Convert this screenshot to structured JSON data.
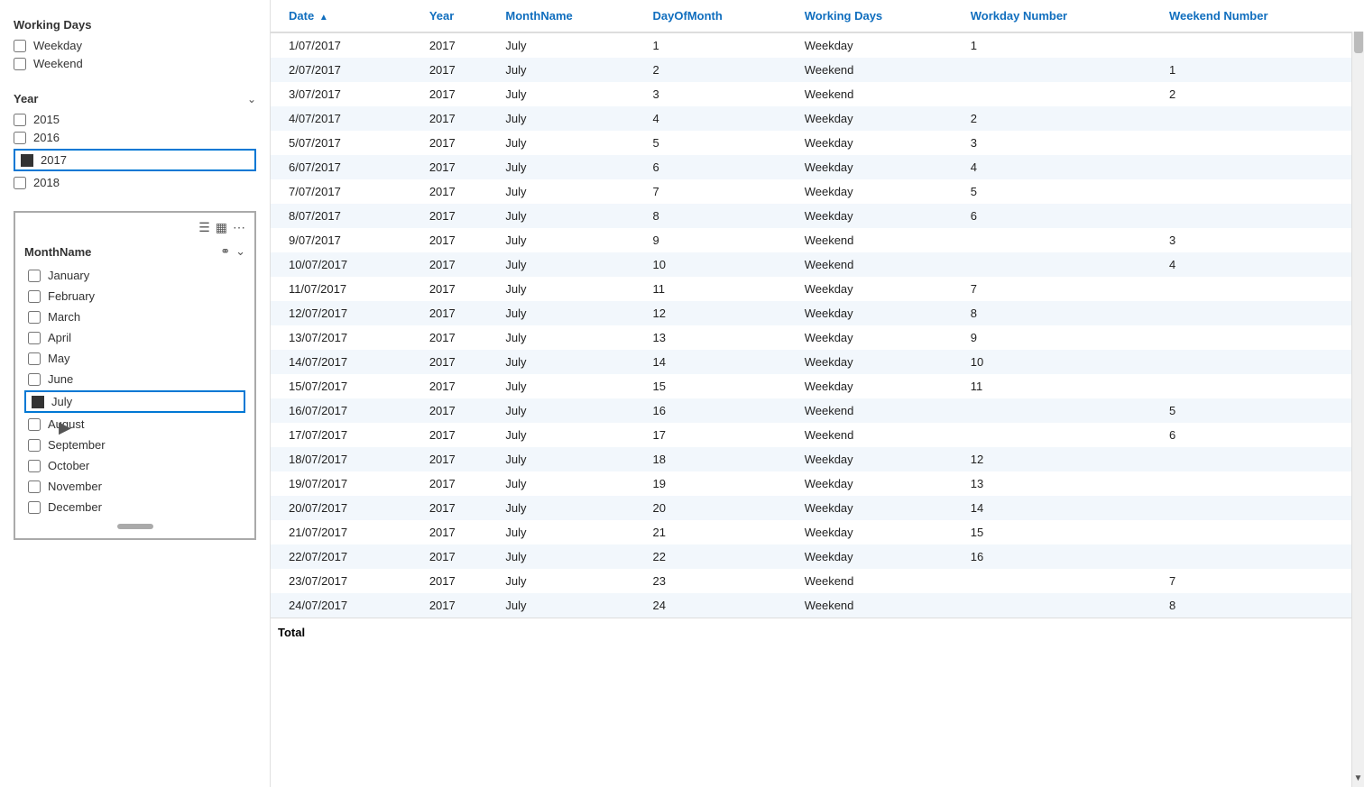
{
  "leftPanel": {
    "workingDays": {
      "title": "Working Days",
      "options": [
        {
          "label": "Weekday",
          "checked": false
        },
        {
          "label": "Weekend",
          "checked": false
        }
      ]
    },
    "year": {
      "title": "Year",
      "options": [
        {
          "label": "2015",
          "checked": false,
          "selected": false
        },
        {
          "label": "2016",
          "checked": false,
          "selected": false
        },
        {
          "label": "2017",
          "checked": true,
          "selected": true
        },
        {
          "label": "2018",
          "checked": false,
          "selected": false
        }
      ]
    },
    "monthName": {
      "title": "MonthName",
      "months": [
        {
          "label": "January",
          "checked": false,
          "selected": false
        },
        {
          "label": "February",
          "checked": false,
          "selected": false
        },
        {
          "label": "March",
          "checked": false,
          "selected": false
        },
        {
          "label": "April",
          "checked": false,
          "selected": false
        },
        {
          "label": "May",
          "checked": false,
          "selected": false
        },
        {
          "label": "June",
          "checked": false,
          "selected": false
        },
        {
          "label": "July",
          "checked": true,
          "selected": true
        },
        {
          "label": "August",
          "checked": false,
          "selected": false
        },
        {
          "label": "September",
          "checked": false,
          "selected": false
        },
        {
          "label": "October",
          "checked": false,
          "selected": false
        },
        {
          "label": "November",
          "checked": false,
          "selected": false
        },
        {
          "label": "December",
          "checked": false,
          "selected": false
        }
      ]
    }
  },
  "table": {
    "columns": [
      {
        "id": "date",
        "label": "Date",
        "sortable": true,
        "sortDir": "asc"
      },
      {
        "id": "year",
        "label": "Year"
      },
      {
        "id": "monthName",
        "label": "MonthName"
      },
      {
        "id": "dayOfMonth",
        "label": "DayOfMonth"
      },
      {
        "id": "workingDays",
        "label": "Working Days"
      },
      {
        "id": "workdayNumber",
        "label": "Workday Number"
      },
      {
        "id": "weekendNumber",
        "label": "Weekend Number"
      }
    ],
    "rows": [
      {
        "date": "1/07/2017",
        "year": "2017",
        "monthName": "July",
        "dayOfMonth": "1",
        "workingDays": "Weekday",
        "workdayNumber": "1",
        "weekendNumber": ""
      },
      {
        "date": "2/07/2017",
        "year": "2017",
        "monthName": "July",
        "dayOfMonth": "2",
        "workingDays": "Weekend",
        "workdayNumber": "",
        "weekendNumber": "1"
      },
      {
        "date": "3/07/2017",
        "year": "2017",
        "monthName": "July",
        "dayOfMonth": "3",
        "workingDays": "Weekend",
        "workdayNumber": "",
        "weekendNumber": "2"
      },
      {
        "date": "4/07/2017",
        "year": "2017",
        "monthName": "July",
        "dayOfMonth": "4",
        "workingDays": "Weekday",
        "workdayNumber": "2",
        "weekendNumber": ""
      },
      {
        "date": "5/07/2017",
        "year": "2017",
        "monthName": "July",
        "dayOfMonth": "5",
        "workingDays": "Weekday",
        "workdayNumber": "3",
        "weekendNumber": ""
      },
      {
        "date": "6/07/2017",
        "year": "2017",
        "monthName": "July",
        "dayOfMonth": "6",
        "workingDays": "Weekday",
        "workdayNumber": "4",
        "weekendNumber": ""
      },
      {
        "date": "7/07/2017",
        "year": "2017",
        "monthName": "July",
        "dayOfMonth": "7",
        "workingDays": "Weekday",
        "workdayNumber": "5",
        "weekendNumber": ""
      },
      {
        "date": "8/07/2017",
        "year": "2017",
        "monthName": "July",
        "dayOfMonth": "8",
        "workingDays": "Weekday",
        "workdayNumber": "6",
        "weekendNumber": ""
      },
      {
        "date": "9/07/2017",
        "year": "2017",
        "monthName": "July",
        "dayOfMonth": "9",
        "workingDays": "Weekend",
        "workdayNumber": "",
        "weekendNumber": "3"
      },
      {
        "date": "10/07/2017",
        "year": "2017",
        "monthName": "July",
        "dayOfMonth": "10",
        "workingDays": "Weekend",
        "workdayNumber": "",
        "weekendNumber": "4"
      },
      {
        "date": "11/07/2017",
        "year": "2017",
        "monthName": "July",
        "dayOfMonth": "11",
        "workingDays": "Weekday",
        "workdayNumber": "7",
        "weekendNumber": ""
      },
      {
        "date": "12/07/2017",
        "year": "2017",
        "monthName": "July",
        "dayOfMonth": "12",
        "workingDays": "Weekday",
        "workdayNumber": "8",
        "weekendNumber": ""
      },
      {
        "date": "13/07/2017",
        "year": "2017",
        "monthName": "July",
        "dayOfMonth": "13",
        "workingDays": "Weekday",
        "workdayNumber": "9",
        "weekendNumber": ""
      },
      {
        "date": "14/07/2017",
        "year": "2017",
        "monthName": "July",
        "dayOfMonth": "14",
        "workingDays": "Weekday",
        "workdayNumber": "10",
        "weekendNumber": ""
      },
      {
        "date": "15/07/2017",
        "year": "2017",
        "monthName": "July",
        "dayOfMonth": "15",
        "workingDays": "Weekday",
        "workdayNumber": "11",
        "weekendNumber": ""
      },
      {
        "date": "16/07/2017",
        "year": "2017",
        "monthName": "July",
        "dayOfMonth": "16",
        "workingDays": "Weekend",
        "workdayNumber": "",
        "weekendNumber": "5"
      },
      {
        "date": "17/07/2017",
        "year": "2017",
        "monthName": "July",
        "dayOfMonth": "17",
        "workingDays": "Weekend",
        "workdayNumber": "",
        "weekendNumber": "6"
      },
      {
        "date": "18/07/2017",
        "year": "2017",
        "monthName": "July",
        "dayOfMonth": "18",
        "workingDays": "Weekday",
        "workdayNumber": "12",
        "weekendNumber": ""
      },
      {
        "date": "19/07/2017",
        "year": "2017",
        "monthName": "July",
        "dayOfMonth": "19",
        "workingDays": "Weekday",
        "workdayNumber": "13",
        "weekendNumber": ""
      },
      {
        "date": "20/07/2017",
        "year": "2017",
        "monthName": "July",
        "dayOfMonth": "20",
        "workingDays": "Weekday",
        "workdayNumber": "14",
        "weekendNumber": ""
      },
      {
        "date": "21/07/2017",
        "year": "2017",
        "monthName": "July",
        "dayOfMonth": "21",
        "workingDays": "Weekday",
        "workdayNumber": "15",
        "weekendNumber": ""
      },
      {
        "date": "22/07/2017",
        "year": "2017",
        "monthName": "July",
        "dayOfMonth": "22",
        "workingDays": "Weekday",
        "workdayNumber": "16",
        "weekendNumber": ""
      },
      {
        "date": "23/07/2017",
        "year": "2017",
        "monthName": "July",
        "dayOfMonth": "23",
        "workingDays": "Weekend",
        "workdayNumber": "",
        "weekendNumber": "7"
      },
      {
        "date": "24/07/2017",
        "year": "2017",
        "monthName": "July",
        "dayOfMonth": "24",
        "workingDays": "Weekend",
        "workdayNumber": "",
        "weekendNumber": "8"
      }
    ],
    "totalLabel": "Total"
  }
}
